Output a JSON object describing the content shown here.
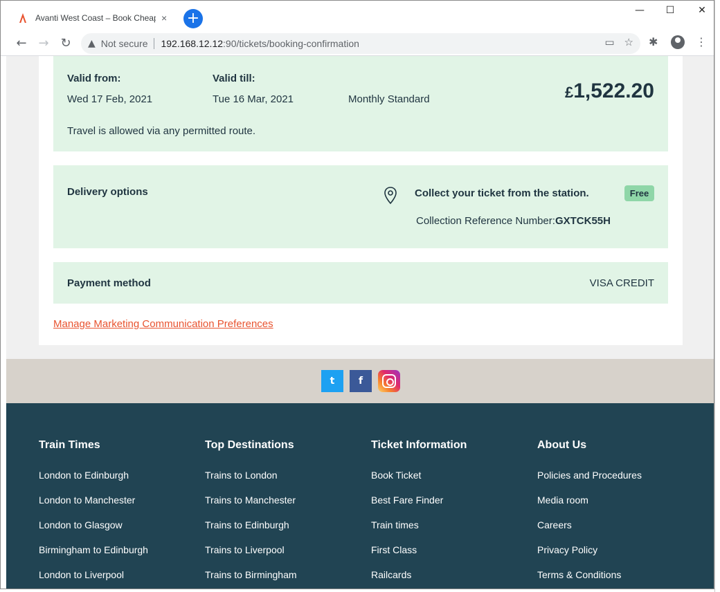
{
  "browser": {
    "tab_title": "Avanti West Coast – Book Cheap",
    "tab_close": "×",
    "new_tab": "+",
    "security_label": "Not secure",
    "url_host": "192.168.12.12",
    "url_rest": ":90/tickets/booking-confirmation",
    "window_controls": {
      "minimize": "—",
      "maximize": "☐",
      "close": "✕"
    }
  },
  "ticket": {
    "valid_from_label": "Valid from:",
    "valid_from": "Wed 17 Feb, 2021",
    "valid_till_label": "Valid till:",
    "valid_till": "Tue 16 Mar, 2021",
    "ticket_type": "Monthly Standard",
    "price_symbol": "£",
    "price_amount": "1,522.20",
    "route_note": "Travel is allowed via any permitted route."
  },
  "delivery": {
    "label": "Delivery options",
    "method": "Collect your ticket from the station.",
    "badge": "Free",
    "reference_label": "Collection Reference Number:",
    "reference_code": "GXTCK55H"
  },
  "payment": {
    "label": "Payment method",
    "value": "VISA CREDIT"
  },
  "marketing_link": "Manage Marketing Communication Preferences",
  "social": {
    "twitter": "t",
    "facebook": "f"
  },
  "footer": {
    "columns": [
      {
        "heading": "Train Times",
        "links": [
          "London to Edinburgh",
          "London to Manchester",
          "London to Glasgow",
          "Birmingham to Edinburgh",
          "London to Liverpool"
        ]
      },
      {
        "heading": "Top Destinations",
        "links": [
          "Trains to London",
          "Trains to Manchester",
          "Trains to Edinburgh",
          "Trains to Liverpool",
          "Trains to Birmingham"
        ]
      },
      {
        "heading": "Ticket Information",
        "links": [
          "Book Ticket",
          "Best Fare Finder",
          "Train times",
          "First Class",
          "Railcards"
        ]
      },
      {
        "heading": "About Us",
        "links": [
          "Policies and Procedures",
          "Media room",
          "Careers",
          "Privacy Policy",
          "Terms & Conditions"
        ]
      }
    ]
  },
  "colors": {
    "panel_bg": "#e1f4e6",
    "footer_bg": "#214453",
    "social_band_bg": "#d7d2cb",
    "link": "#e8532f",
    "badge_bg": "#8fd6a8"
  }
}
